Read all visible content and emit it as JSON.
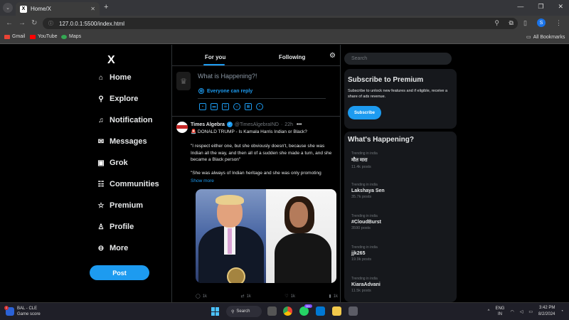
{
  "browser": {
    "tab_title": "Home/X",
    "tab_favicon": "X",
    "url": "127.0.0.1:5500/index.html",
    "profile_initial": "S",
    "bookmarks": [
      {
        "label": "Gmail",
        "color": "#ea4335"
      },
      {
        "label": "YouTube",
        "color": "#ff0000"
      },
      {
        "label": "Maps",
        "color": "#34a853"
      }
    ],
    "all_bookmarks": "All Bookmarks"
  },
  "sidebar": {
    "logo": "X",
    "items": [
      {
        "label": "Home",
        "icon": "home-icon",
        "glyph": "⌂"
      },
      {
        "label": "Explore",
        "icon": "search-icon",
        "glyph": "⚲"
      },
      {
        "label": "Notification",
        "icon": "bell-icon",
        "glyph": "♫"
      },
      {
        "label": "Messages",
        "icon": "mail-icon",
        "glyph": "✉"
      },
      {
        "label": "Grok",
        "icon": "grok-icon",
        "glyph": "▣"
      },
      {
        "label": "Communities",
        "icon": "people-icon",
        "glyph": "☷"
      },
      {
        "label": "Premium",
        "icon": "star-icon",
        "glyph": "☆"
      },
      {
        "label": "Profile",
        "icon": "user-icon",
        "glyph": "♙"
      },
      {
        "label": "More",
        "icon": "more-icon",
        "glyph": "⊖"
      }
    ],
    "post_button": "Post"
  },
  "feed": {
    "tabs": [
      "For you",
      "Following"
    ],
    "composer": {
      "placeholder": "What is Happening?!",
      "audience": "Everyone can reply"
    },
    "tweet": {
      "name": "Times Algebra",
      "handle": "@TimesAlgebraIND",
      "time": "22h",
      "line1": "🚨 DONALD TRUMP - Is Kamala Harris Indian or Black?",
      "paragraphs": [
        "\"I respect either one, but she obviously doesn't, because she was Indian all the way, and then all of a sudden she made a turn, and she became a Black person\"",
        "\"She was always of Indian heritage and she was only promoting"
      ],
      "show_more": "Show more",
      "actions": {
        "replies": "1k",
        "reposts": "1k",
        "likes": "1k",
        "views": "1k"
      }
    }
  },
  "right": {
    "search_placeholder": "Search",
    "premium": {
      "title": "Subscribe to Premium",
      "text": "Subscribe to unlock new features and if eligible, receive a share of ads revenue.",
      "button": "Subscribe"
    },
    "happening": {
      "title": "What's Happening?",
      "trends": [
        {
          "context": "Trending in india",
          "topic": "मौत मारा",
          "count": "11.4k posts"
        },
        {
          "context": "Trending in india",
          "topic": "Lakshaya Sen",
          "count": "35.7k posts"
        },
        {
          "context": "Trending in india",
          "topic": "#CloudBurst",
          "count": "3590 posts"
        },
        {
          "context": "Trending in india",
          "topic": "jjk265",
          "count": "19.9k posts"
        },
        {
          "context": "Trending in india",
          "topic": "KiaraAdvani",
          "count": "11.5k posts"
        }
      ]
    }
  },
  "taskbar": {
    "weather_title": "BAL - CLE",
    "weather_sub": "Game score",
    "weather_badge": "1",
    "search": "Search",
    "whatsapp_badge": "99+",
    "lang_top": "ENG",
    "lang_bottom": "IN",
    "time": "3:42 PM",
    "date": "8/2/2024"
  }
}
